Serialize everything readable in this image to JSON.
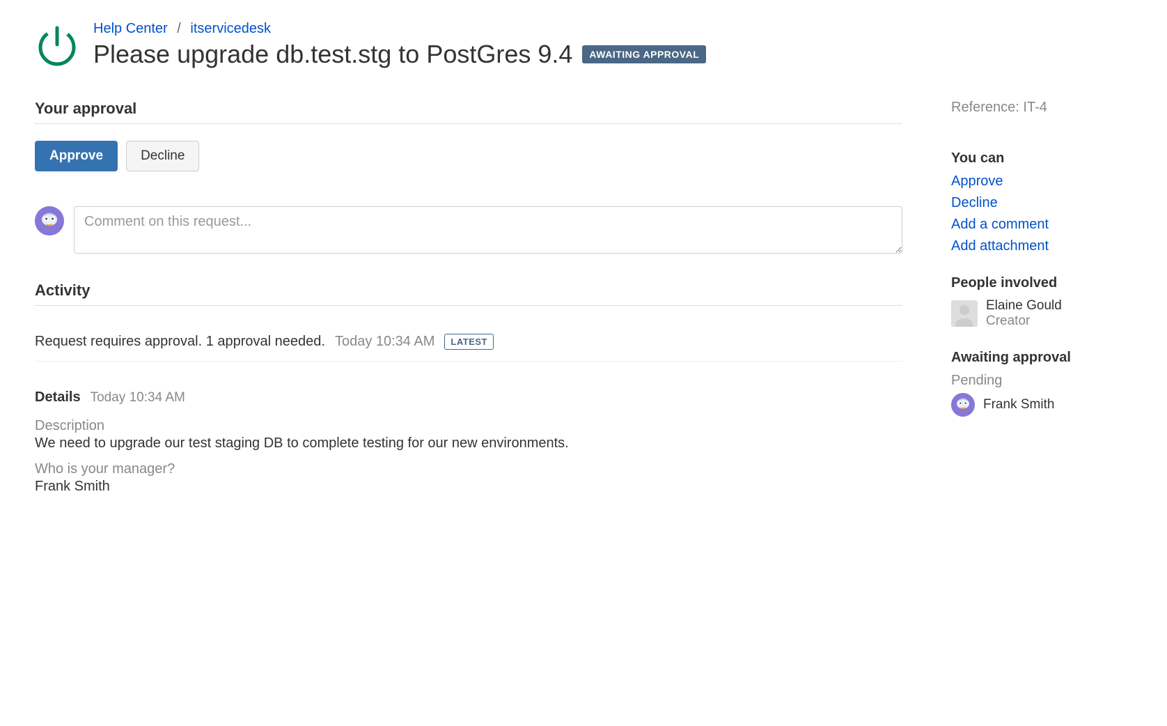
{
  "breadcrumb": {
    "help_center": "Help Center",
    "project": "itservicedesk"
  },
  "title": "Please upgrade db.test.stg to PostGres 9.4",
  "status_badge": "AWAITING APPROVAL",
  "approval": {
    "heading": "Your approval",
    "approve_label": "Approve",
    "decline_label": "Decline"
  },
  "comment": {
    "placeholder": "Comment on this request..."
  },
  "activity": {
    "heading": "Activity",
    "items": [
      {
        "text": "Request requires approval. 1 approval needed.",
        "time": "Today 10:34 AM",
        "latest_badge": "LATEST"
      }
    ]
  },
  "details": {
    "heading": "Details",
    "time": "Today 10:34 AM",
    "fields": [
      {
        "label": "Description",
        "value": "We need to upgrade our test staging DB to complete testing for our new environments."
      },
      {
        "label": "Who is your manager?",
        "value": "Frank Smith"
      }
    ]
  },
  "sidebar": {
    "reference_label": "Reference:",
    "reference_value": "IT-4",
    "you_can_heading": "You can",
    "actions": [
      {
        "label": "Approve"
      },
      {
        "label": "Decline"
      },
      {
        "label": "Add a comment"
      },
      {
        "label": "Add attachment"
      }
    ],
    "people_heading": "People involved",
    "people": [
      {
        "name": "Elaine Gould",
        "role": "Creator"
      }
    ],
    "awaiting_heading": "Awaiting approval",
    "awaiting_status": "Pending",
    "approvers": [
      {
        "name": "Frank Smith"
      }
    ]
  }
}
